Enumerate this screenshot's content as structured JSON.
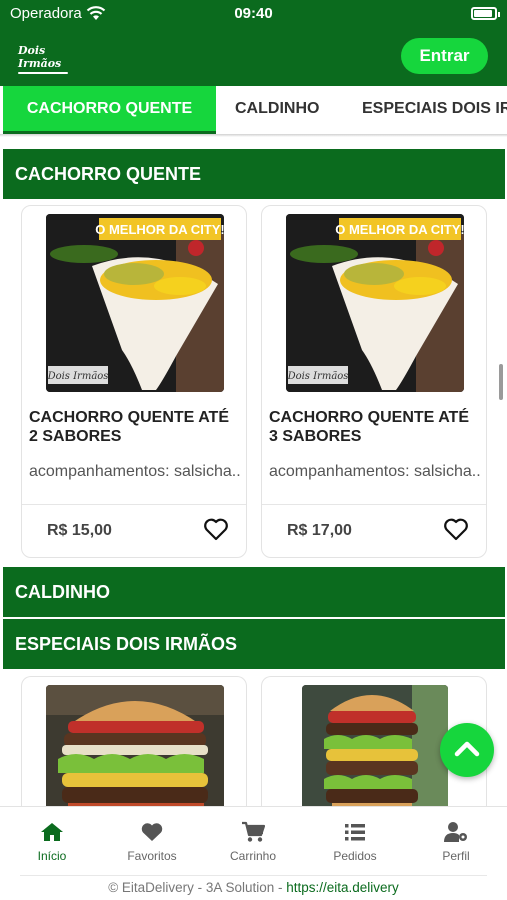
{
  "status_bar": {
    "carrier": "Operadora",
    "time": "09:40"
  },
  "header": {
    "logo_text": "Dois Irmãos",
    "login_label": "Entrar"
  },
  "tabs": [
    {
      "label": "CACHORRO QUENTE",
      "active": true
    },
    {
      "label": "CALDINHO",
      "active": false
    },
    {
      "label": "ESPECIAIS DOIS IRMÃOS",
      "active": false
    }
  ],
  "sections": [
    {
      "title": "CACHORRO QUENTE",
      "products": [
        {
          "image_banner": "O MELHOR DA CITY!",
          "title": "CACHORRO QUENTE ATÉ 2 SABORES",
          "description": "acompanhamentos: salsicha...",
          "price": "R$ 15,00"
        },
        {
          "image_banner": "O MELHOR DA CITY!",
          "title": "CACHORRO QUENTE ATÉ 3 SABORES",
          "description": "acompanhamentos: salsicha...",
          "price": "R$ 17,00"
        }
      ]
    },
    {
      "title": "CALDINHO",
      "products": []
    },
    {
      "title": "ESPECIAIS DOIS IRMÃOS",
      "products": []
    }
  ],
  "bottom_nav": [
    {
      "label": "Início",
      "icon": "home-icon",
      "active": true
    },
    {
      "label": "Favoritos",
      "icon": "heart-icon",
      "active": false
    },
    {
      "label": "Carrinho",
      "icon": "cart-icon",
      "active": false
    },
    {
      "label": "Pedidos",
      "icon": "list-icon",
      "active": false
    },
    {
      "label": "Perfil",
      "icon": "user-settings-icon",
      "active": false
    }
  ],
  "footer": {
    "text": "© EitaDelivery - 3A Solution - ",
    "link": "https://eita.delivery"
  },
  "colors": {
    "primary_dark": "#0b6b1e",
    "primary_bright": "#16d63d"
  }
}
